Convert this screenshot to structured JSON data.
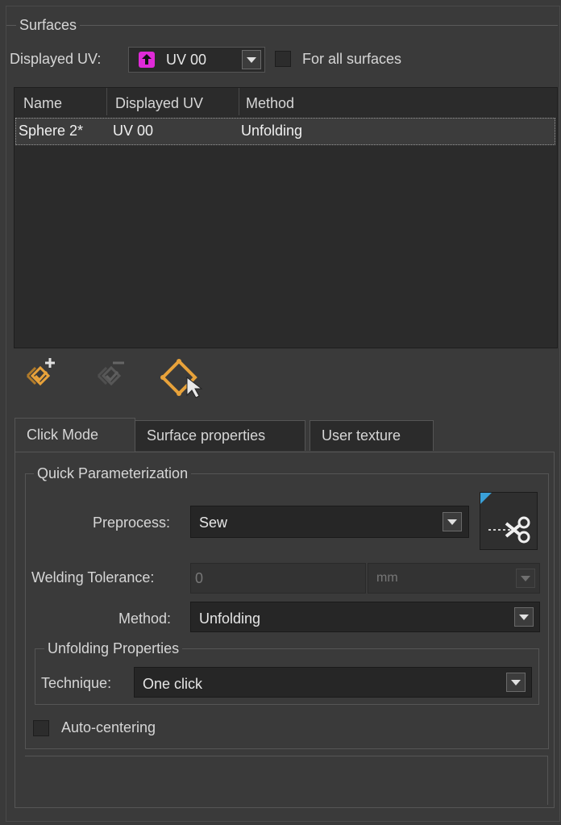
{
  "surfaces": {
    "title": "Surfaces",
    "displayed_uv_label": "Displayed UV:",
    "displayed_uv_value": "UV 00",
    "for_all_label": "For all surfaces",
    "table": {
      "columns": [
        "Name",
        "Displayed UV",
        "Method"
      ],
      "rows": [
        {
          "name": "Sphere 2*",
          "uv": "UV 00",
          "method": "Unfolding"
        }
      ]
    }
  },
  "toolbar": {
    "icons": [
      "add-surface-icon",
      "remove-surface-icon",
      "select-surface-icon"
    ]
  },
  "tabs": [
    "Click Mode",
    "Surface properties",
    "User texture"
  ],
  "quick": {
    "title": "Quick Parameterization",
    "preprocess_label": "Preprocess:",
    "preprocess_value": "Sew",
    "welding_label": "Welding Tolerance:",
    "welding_value": "0",
    "welding_unit": "mm",
    "method_label": "Method:",
    "method_value": "Unfolding",
    "unfolding_title": "Unfolding Properties",
    "technique_label": "Technique:",
    "technique_value": "One click",
    "autocenter_label": "Auto-centering"
  },
  "colors": {
    "accent": "#e8a23a",
    "uv_icon": "#e02ad8",
    "cut_marker": "#3aa0d8"
  }
}
